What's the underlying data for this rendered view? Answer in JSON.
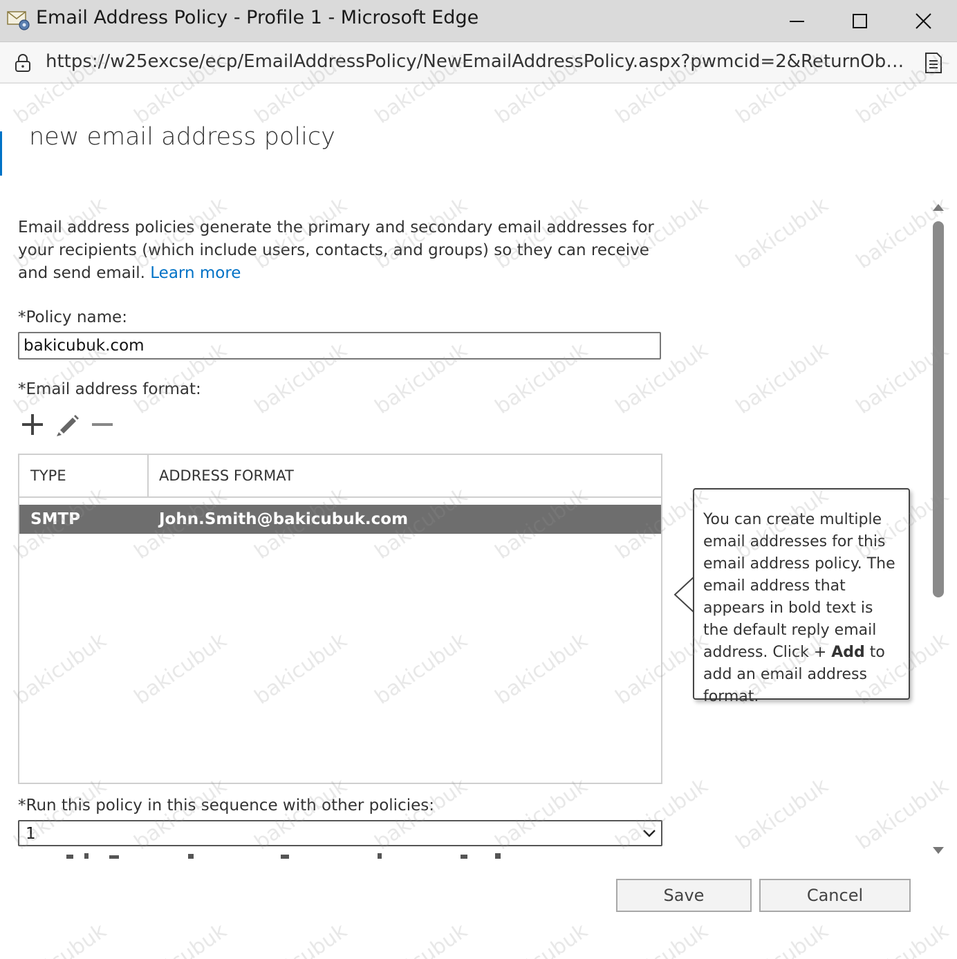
{
  "window": {
    "title": "Email Address Policy - Profile 1 - Microsoft Edge",
    "app_icon": "email-policy-icon",
    "controls": [
      "minimize-icon",
      "maximize-icon",
      "close-icon"
    ]
  },
  "addressbar": {
    "url": "https://w25excse/ecp/EmailAddressPolicy/NewEmailAddressPolicy.aspx?pwmcid=2&ReturnObjectT...",
    "lock_icon": "lock-icon",
    "reader_icon": "reader-mode-icon"
  },
  "page": {
    "title": "new email address policy",
    "description": "Email address policies generate the primary and secondary email addresses for your recipients (which include users, contacts, and groups) so they can receive and send email.",
    "learn_more": "Learn more"
  },
  "form": {
    "policy_name_label": "*Policy name:",
    "policy_name_value": "bakicubuk.com",
    "email_format_label": "*Email address format:",
    "toolbar_icons": [
      "add-icon",
      "edit-icon",
      "remove-icon"
    ],
    "table": {
      "columns": [
        "TYPE",
        "ADDRESS FORMAT"
      ],
      "rows": [
        {
          "type": "SMTP",
          "address_format": "John.Smith@bakicubuk.com",
          "selected": true
        }
      ]
    },
    "sequence_label": "*Run this policy in this sequence with other policies:",
    "sequence_value": "1"
  },
  "callout": {
    "text_before": "You can create multiple email addresses for this email address policy. The email address that appears in bold text is the default reply email address. Click + ",
    "bold": "Add",
    "text_after": " to add an email address format."
  },
  "buttons": {
    "save": "Save",
    "cancel": "Cancel"
  },
  "watermark": "bakicubuk",
  "colors": {
    "accent": "#0072c6",
    "selected_row": "#6e6e6e",
    "titlebar": "#dadada"
  }
}
